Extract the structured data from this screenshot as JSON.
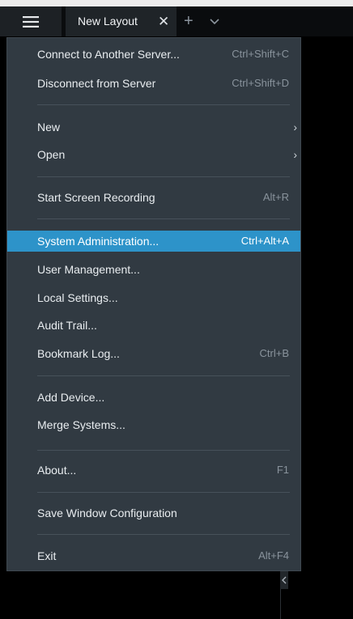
{
  "titlebar": {
    "tab_label": "New Layout",
    "tab_close_glyph": "✕",
    "add_tab_glyph": "+",
    "menu_icon": "hamburger-menu-icon",
    "tab_list_icon": "chevron-down-icon"
  },
  "menu": {
    "connect": {
      "label": "Connect to Another Server...",
      "shortcut": "Ctrl+Shift+C"
    },
    "disconnect": {
      "label": "Disconnect from Server",
      "shortcut": "Ctrl+Shift+D"
    },
    "new": {
      "label": "New",
      "chevron": "›"
    },
    "open": {
      "label": "Open",
      "chevron": "›"
    },
    "recording": {
      "label": "Start Screen Recording",
      "shortcut": "Alt+R"
    },
    "sysadmin": {
      "label": "System Administration...",
      "shortcut": "Ctrl+Alt+A"
    },
    "users": {
      "label": "User Management..."
    },
    "local": {
      "label": "Local Settings..."
    },
    "audit": {
      "label": "Audit Trail..."
    },
    "bookmarks": {
      "label": "Bookmark Log...",
      "shortcut": "Ctrl+B"
    },
    "add_device": {
      "label": "Add Device..."
    },
    "merge": {
      "label": "Merge Systems..."
    },
    "about": {
      "label": "About...",
      "shortcut": "F1"
    },
    "save_config": {
      "label": "Save Window Configuration"
    },
    "exit": {
      "label": "Exit",
      "shortcut": "Alt+F4"
    }
  },
  "colors": {
    "highlight": "#2d93c9",
    "menu_bg": "#313a42",
    "titlebar_bg": "#0a0c0e"
  }
}
